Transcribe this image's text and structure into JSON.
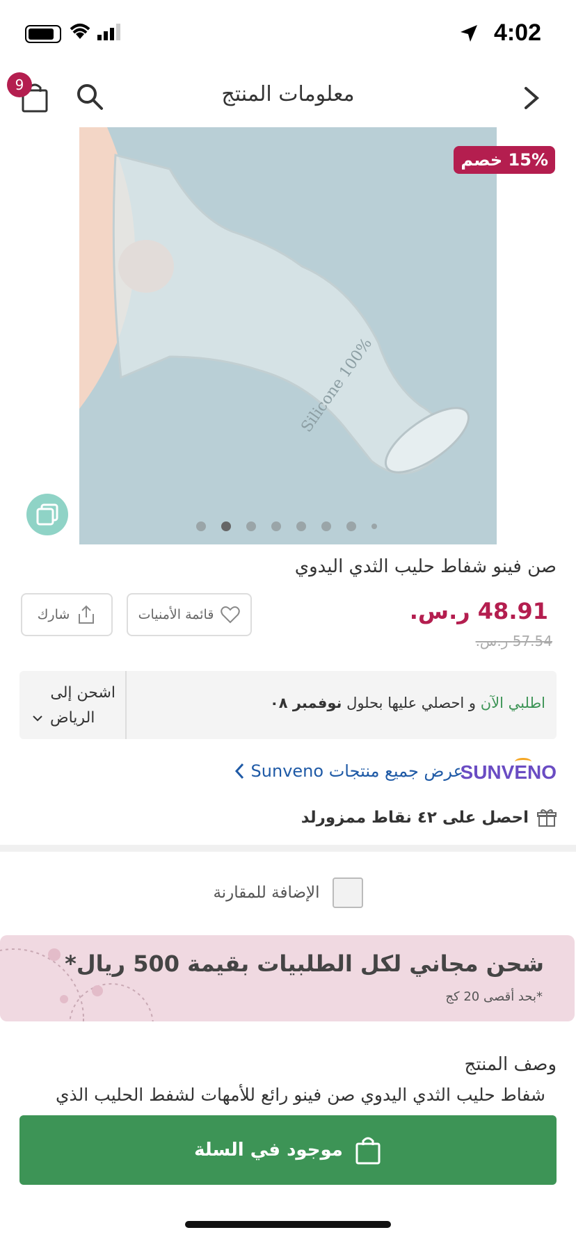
{
  "status_bar": {
    "time": "4:02"
  },
  "header": {
    "title": "معلومات المنتج",
    "cart_count": "9"
  },
  "product": {
    "discount_badge": "15% خصم",
    "name": "صن فينو شفاط حليب الثدي اليدوي",
    "price": "48.91 ر.س.",
    "old_price": "57.54 ر.س.",
    "image_text": "Silicone 100%",
    "carousel": {
      "count": 8,
      "active_index": 1
    }
  },
  "actions": {
    "wishlist_label": "قائمة الأمنيات",
    "share_label": "شارك"
  },
  "shipping": {
    "order_now": "اطلبي الآن",
    "middle_text": " و احصلي عليها بحلول ",
    "date": "نوفمبر ٠٨",
    "ship_to_label": "اشحن إلى",
    "city": "الرياض"
  },
  "brand": {
    "logo_text": "SUNVENO",
    "view_all": "عرض جميع منتجات Sunveno"
  },
  "points": {
    "text": "احصل على ٤٢ نقاط ممزورلد"
  },
  "compare": {
    "label": "الإضافة للمقارنة"
  },
  "banner": {
    "title": "شحن مجاني لكل الطلبيات بقيمة 500 ريال*",
    "subtitle": "*بحد أقصى 20 كج"
  },
  "description": {
    "title": "وصف المنتج",
    "text": "شفاط حليب الثدي اليدوي صن فينو رائع للأمهات لشفط الحليب الذي"
  },
  "cart_button": {
    "label": "موجود في السلة"
  },
  "colors": {
    "accent": "#b41e4f",
    "green": "#3d9456",
    "link": "#1f5aa6"
  }
}
